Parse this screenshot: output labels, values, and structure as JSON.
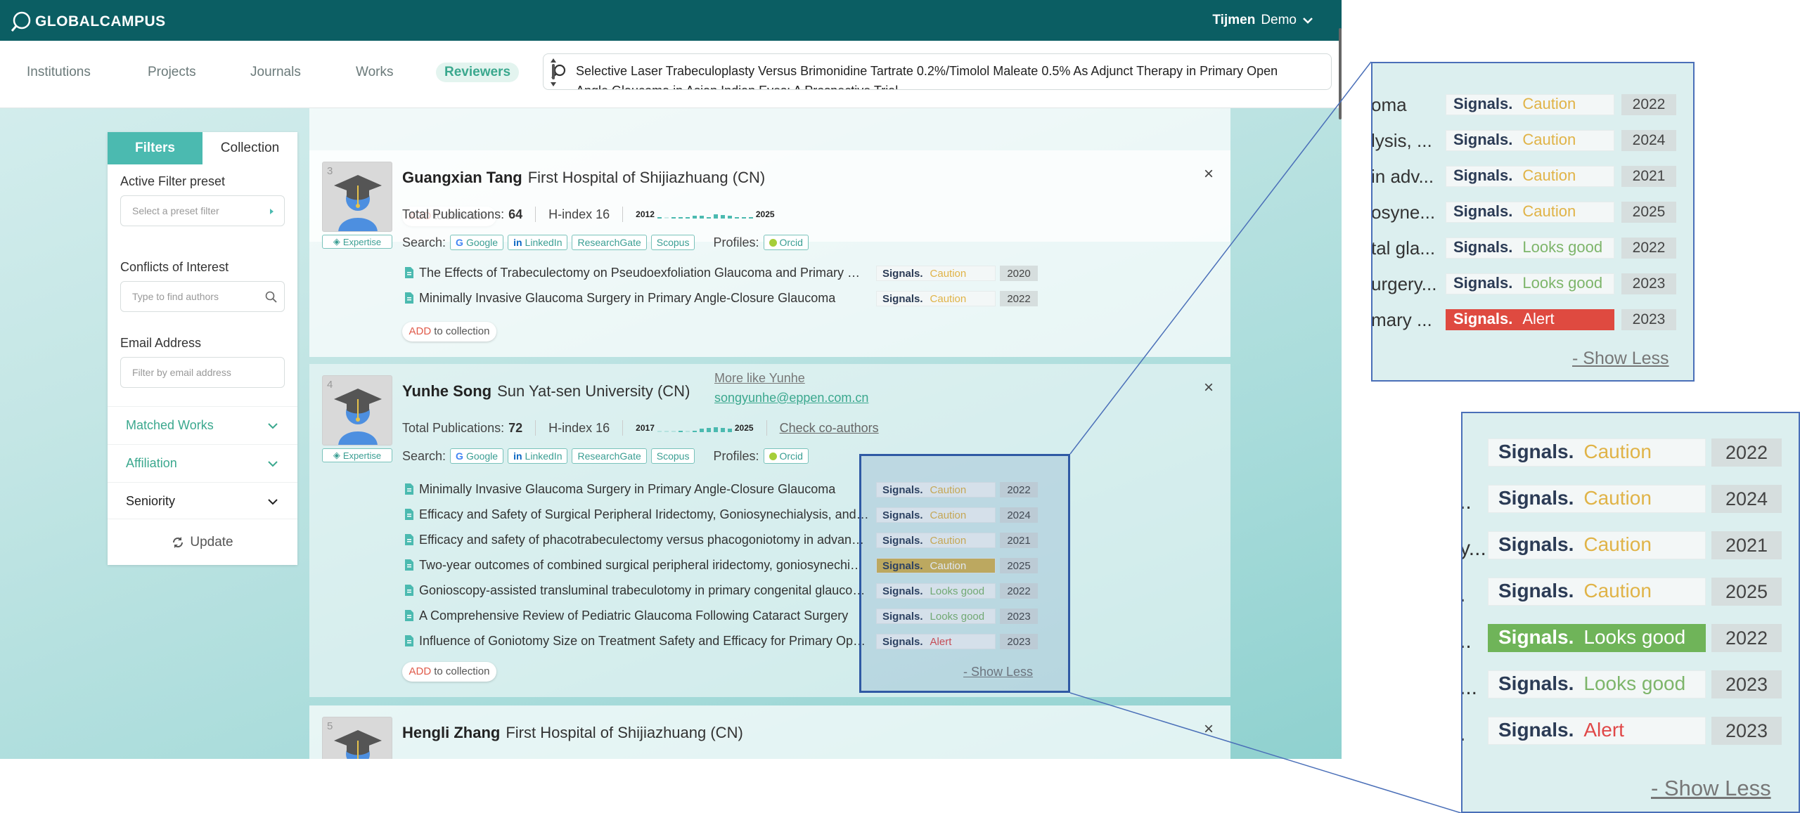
{
  "header": {
    "logo_text": "GLOBALCAMPUS",
    "user_first": "Tijmen",
    "user_last": "Demo"
  },
  "nav": {
    "items": [
      "Institutions",
      "Projects",
      "Journals",
      "Works",
      "Reviewers"
    ],
    "active": "Reviewers"
  },
  "search": {
    "query": "Selective Laser Trabeculoplasty Versus Brimonidine Tartrate 0.2%/Timolol Maleate 0.5% As Adjunct Therapy in Primary Open Angle Glaucoma in Asian Indian Eyes: A Prospective Trial"
  },
  "sidebar": {
    "tabs": [
      "Filters",
      "Collection"
    ],
    "active_filter_label": "Active Filter preset",
    "preset_placeholder": "Select a preset filter",
    "coi_label": "Conflicts of Interest",
    "coi_placeholder": "Type to find authors",
    "email_label": "Email Address",
    "email_placeholder": "Filter by email address",
    "sections": [
      "Matched Works",
      "Affiliation",
      "Seniority"
    ],
    "update_label": "Update"
  },
  "common": {
    "add_to_collection_prefix": "ADD",
    "add_to_collection_suffix": "to collection",
    "expertise": "Expertise",
    "search_label": "Search:",
    "profiles_label": "Profiles:",
    "search_links": [
      "Google",
      "LinkedIn",
      "ResearchGate",
      "Scopus"
    ],
    "profile_links": [
      "Orcid"
    ],
    "signals": "Signals.",
    "total_pubs_label": "Total Publications:",
    "close": "×",
    "show_less": "- Show Less"
  },
  "reviewers": [
    {
      "index": "3",
      "name": "Guangxian Tang",
      "affiliation": "First Hospital of Shijiazhuang (CN)",
      "total_publications": "64",
      "h_index": "H-index 16",
      "spark_start": "2012",
      "spark_end": "2025",
      "spark": [
        0.1,
        0,
        0.1,
        0.1,
        0.2,
        0.3,
        0.3,
        0.2,
        0.5,
        0.4,
        0.3,
        0.2,
        0.2,
        0.1
      ],
      "works": [
        {
          "title": "The Effects of Trabeculectomy on Pseudoexfoliation Glaucoma and Primary Open-Angle Glaucoma",
          "signal": "Caution",
          "year": "2020"
        },
        {
          "title": "Minimally Invasive Glaucoma Surgery in Primary Angle-Closure Glaucoma",
          "signal": "Caution",
          "year": "2022"
        }
      ]
    },
    {
      "index": "4",
      "name": "Yunhe Song",
      "affiliation": "Sun Yat-sen University (CN)",
      "more_like": "More like Yunhe",
      "email": "songyunhe@eppen.com.cn",
      "coauthors": "Check co-authors",
      "total_publications": "72",
      "h_index": "H-index 16",
      "spark_start": "2017",
      "spark_end": "2025",
      "spark": [
        0,
        0,
        0,
        0.1,
        0,
        0.2,
        0.4,
        0.5,
        0.6,
        0.5,
        0.4
      ],
      "works": [
        {
          "title": "Minimally Invasive Glaucoma Surgery in Primary Angle-Closure Glaucoma",
          "signal": "Caution",
          "year": "2022"
        },
        {
          "title": "Efficacy and Safety of Surgical Peripheral Iridectomy, Goniosynechialysis, and Goniotomy",
          "signal": "Caution",
          "year": "2024"
        },
        {
          "title": "Efficacy and safety of phacotrabeculectomy versus phacogoniotomy in advanced glaucoma",
          "signal": "Caution",
          "year": "2021"
        },
        {
          "title": "Two-year outcomes of combined surgical peripheral iridectomy, goniosynechialysis",
          "signal": "Caution",
          "year": "2025"
        },
        {
          "title": "Gonioscopy-assisted transluminal trabeculotomy in primary congenital glaucoma",
          "signal": "Looks good",
          "year": "2022"
        },
        {
          "title": "A Comprehensive Review of Pediatric Glaucoma Following Cataract Surgery",
          "signal": "Looks good",
          "year": "2023"
        },
        {
          "title": "Influence of Goniotomy Size on Treatment Safety and Efficacy for Primary Open-Angle Glaucoma",
          "signal": "Alert",
          "year": "2023"
        }
      ]
    },
    {
      "index": "5",
      "name": "Hengli Zhang",
      "affiliation": "First Hospital of Shijiazhuang (CN)"
    }
  ],
  "zoom1": {
    "rows": [
      {
        "text": "oma",
        "signal": "Caution",
        "year": "2022"
      },
      {
        "text": "lysis, ...",
        "signal": "Caution",
        "year": "2024"
      },
      {
        "text": "in adv...",
        "signal": "Caution",
        "year": "2021"
      },
      {
        "text": "osyne...",
        "signal": "Caution",
        "year": "2025"
      },
      {
        "text": "tal gla...",
        "signal": "Looks good",
        "year": "2022"
      },
      {
        "text": "urgery...",
        "signal": "Looks good",
        "year": "2023"
      },
      {
        "text": "mary ...",
        "signal": "Alert",
        "year": "2023"
      }
    ]
  },
  "zoom2": {
    "rows": [
      {
        "text": "",
        "signal": "Caution",
        "year": "2022"
      },
      {
        "text": "..",
        "signal": "Caution",
        "year": "2024"
      },
      {
        "text": "y...",
        "signal": "Caution",
        "year": "2021"
      },
      {
        "text": ".",
        "signal": "Caution",
        "year": "2025"
      },
      {
        "text": "..",
        "signal": "Looks good",
        "year": "2022"
      },
      {
        "text": "...",
        "signal": "Looks good",
        "year": "2023"
      },
      {
        "text": ".",
        "signal": "Alert",
        "year": "2023"
      }
    ]
  },
  "colors": {
    "brand": "#0b5e63",
    "accent": "#4bbab0",
    "caution": "#e0b347",
    "good": "#7db56a",
    "alert": "#e04848"
  }
}
